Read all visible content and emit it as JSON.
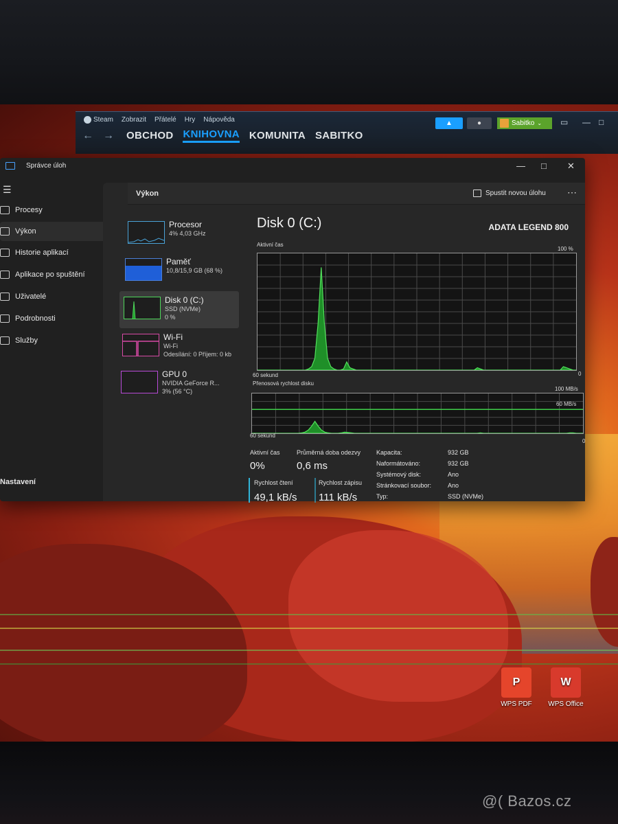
{
  "steam": {
    "menu": [
      "Steam",
      "Zobrazit",
      "Přátelé",
      "Hry",
      "Nápověda"
    ],
    "tabs": [
      "OBCHOD",
      "KNIHOVNA",
      "KOMUNITA",
      "SABITKO"
    ],
    "active_tab": "KNIHOVNA",
    "user": "Sabitko",
    "accent": "#1a9fff"
  },
  "taskmgr": {
    "title": "Správce úloh",
    "nav": [
      "Procesy",
      "Výkon",
      "Historie aplikací",
      "Aplikace po spuštění",
      "Uživatelé",
      "Podrobnosti",
      "Služby"
    ],
    "active_nav": "Výkon",
    "settings_label": "Nastavení",
    "page_title": "Výkon",
    "run_task": "Spustit novou úlohu",
    "devices": [
      {
        "name": "Procesor",
        "sub1": "4% 4,03 GHz",
        "sub2": ""
      },
      {
        "name": "Paměť",
        "sub1": "10,8/15,9 GB (68 %)",
        "sub2": ""
      },
      {
        "name": "Disk 0 (C:)",
        "sub1": "SSD (NVMe)",
        "sub2": "0 %"
      },
      {
        "name": "Wi-Fi",
        "sub1": "Wi-Fi",
        "sub2": "Odesílání: 0 Příjem: 0 kb"
      },
      {
        "name": "GPU 0",
        "sub1": "NVIDIA GeForce R...",
        "sub2": "3% (56 °C)"
      }
    ],
    "memory_fill": 0.68,
    "detail": {
      "title": "Disk 0 (C:)",
      "model": "ADATA LEGEND 800",
      "graph1_label": "Aktivní čas",
      "graph1_max": "100 %",
      "graph1_time": "60 sekund",
      "graph1_min": "0",
      "graph2_label": "Přenosová rychlost disku",
      "graph2_max": "100 MB/s",
      "graph2_line": "60 MB/s",
      "graph2_time": "60 sekund",
      "graph2_min": "0",
      "active_time_label": "Aktivní čas",
      "active_time": "0%",
      "response_label": "Průměrná doba odezvy",
      "response": "0,6 ms",
      "read_label": "Rychlost čtení",
      "read": "49,1 kB/s",
      "write_label": "Rychlost zápisu",
      "write": "111 kB/s",
      "props": [
        {
          "k": "Kapacita:",
          "v": "932 GB"
        },
        {
          "k": "Naformátováno:",
          "v": "932 GB"
        },
        {
          "k": "Systémový disk:",
          "v": "Ano"
        },
        {
          "k": "Stránkovací soubor:",
          "v": "Ano"
        },
        {
          "k": "Typ:",
          "v": "SSD (NVMe)"
        }
      ]
    },
    "active_time_series": [
      0,
      0,
      0,
      0,
      0,
      0,
      0,
      0,
      0,
      0,
      0,
      0,
      0,
      0,
      0,
      0,
      1,
      3,
      10,
      40,
      88,
      40,
      10,
      3,
      1,
      0,
      0,
      1,
      7,
      2,
      1,
      0,
      0,
      0,
      0,
      0,
      0,
      0,
      0,
      0,
      0,
      0,
      0,
      0,
      0,
      0,
      0,
      0,
      0,
      0,
      0,
      0,
      0,
      0,
      0,
      0,
      0,
      0,
      0,
      0,
      0,
      0,
      0,
      0,
      0,
      0,
      0,
      0,
      0,
      2,
      1,
      0,
      0,
      0,
      0,
      0,
      0,
      0,
      0,
      0,
      0,
      0,
      0,
      0,
      0,
      0,
      0,
      0,
      0,
      0,
      0,
      0,
      0,
      0,
      0,
      0,
      3,
      2,
      1,
      0,
      0
    ],
    "transfer_series": [
      0,
      0,
      0,
      0,
      0,
      0,
      0,
      0,
      0,
      0,
      0,
      0,
      0,
      0,
      0,
      1,
      3,
      8,
      18,
      30,
      18,
      8,
      3,
      1,
      0,
      0,
      0,
      1,
      3,
      2,
      1,
      0,
      0,
      0,
      0,
      0,
      0,
      0,
      0,
      0,
      0,
      0,
      0,
      0,
      0,
      0,
      0,
      0,
      0,
      0,
      0,
      0,
      0,
      0,
      0,
      0,
      0,
      0,
      0,
      0,
      0,
      0,
      0,
      0,
      0,
      0,
      0,
      0,
      0,
      1,
      0,
      0,
      0,
      0,
      0,
      0,
      0,
      0,
      0,
      0,
      0,
      0,
      0,
      0,
      0,
      0,
      0,
      0,
      0,
      0,
      0,
      0,
      0,
      0,
      0,
      0,
      1,
      1,
      0,
      0,
      0
    ]
  },
  "desktop": {
    "icons": [
      {
        "label": "WPS PDF",
        "color": "#e5452b",
        "glyph": "P"
      },
      {
        "label": "WPS Office",
        "color": "#d83a2c",
        "glyph": "W"
      }
    ]
  },
  "watermark": "@( Bazos.cz"
}
